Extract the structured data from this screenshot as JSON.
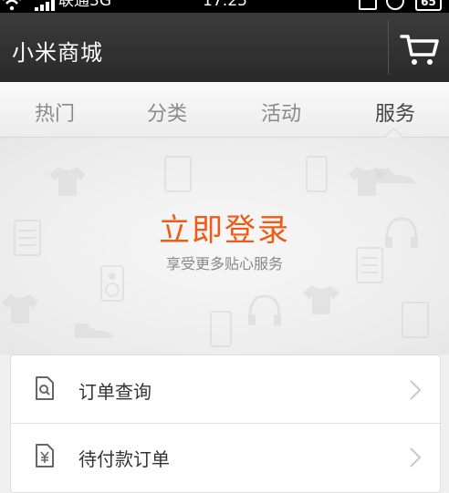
{
  "status_bar": {
    "carrier": "联通3G",
    "time": "17:25",
    "battery": "65"
  },
  "header": {
    "title": "小米商城",
    "cart_icon": "cart-icon"
  },
  "tabs": [
    {
      "label": "热门",
      "active": false
    },
    {
      "label": "分类",
      "active": false
    },
    {
      "label": "活动",
      "active": false
    },
    {
      "label": "服务",
      "active": true
    }
  ],
  "banner": {
    "login_title": "立即登录",
    "login_subtitle": "享受更多贴心服务"
  },
  "list": [
    {
      "label": "订单查询",
      "icon": "order-search-icon"
    },
    {
      "label": "待付款订单",
      "icon": "pending-payment-icon"
    }
  ],
  "colors": {
    "accent": "#f05a15",
    "titlebar": "#2f2f2f"
  }
}
